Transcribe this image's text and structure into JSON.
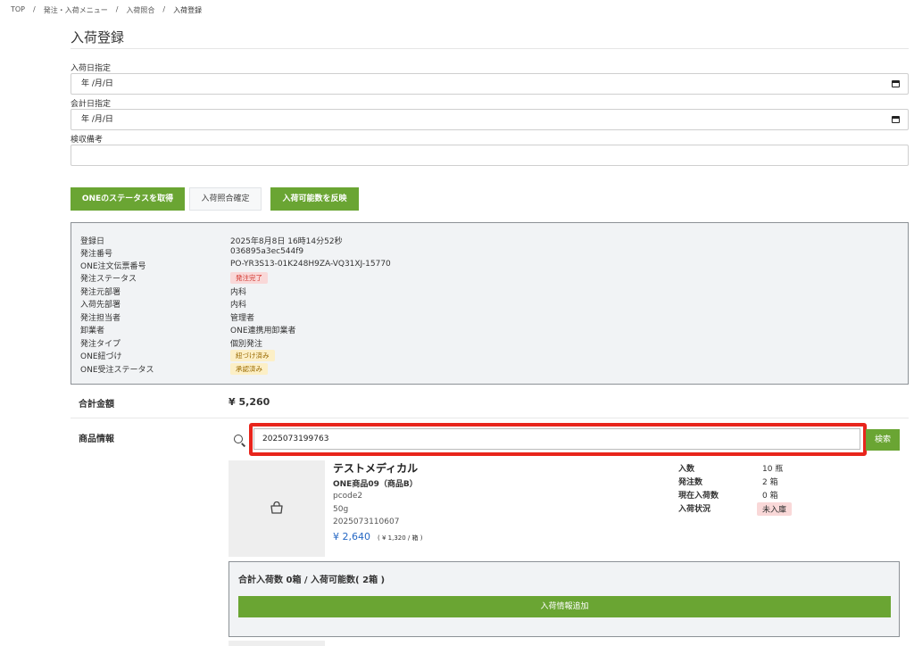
{
  "breadcrumb": [
    "TOP",
    "発注・入荷メニュー",
    "入荷照合",
    "入荷登録"
  ],
  "breadcrumb_sep": "/",
  "page_title": "入荷登録",
  "form": {
    "arrival_date_label": "入荷日指定",
    "arrival_date_value": "年 /月/日",
    "accounting_date_label": "会計日指定",
    "accounting_date_value": "年 /月/日",
    "inspection_note_label": "検収備考",
    "inspection_note_value": ""
  },
  "buttons": {
    "get_one_status": "ONEのステータスを取得",
    "confirm_matching": "入荷照合確定",
    "apply_available": "入荷可能数を反映"
  },
  "order_info": {
    "registered_label": "登録日",
    "registered_value": "2025年8月8日 16時14分52秒",
    "order_no_label": "発注番号",
    "order_no_value": "036895a3ec544f9",
    "one_slip_label": "ONE注文伝票番号",
    "one_slip_value": "PO-YR3S13-01K248H9ZA-VQ31XJ-15770",
    "order_status_label": "発注ステータス",
    "order_status_value": "発注完了",
    "from_dept_label": "発注元部署",
    "from_dept_value": "内科",
    "to_dept_label": "入荷先部署",
    "to_dept_value": "内科",
    "staff_label": "発注担当者",
    "staff_value": "管理者",
    "wholesaler_label": "卸業者",
    "wholesaler_value": "ONE連携用卸業者",
    "type_label": "発注タイプ",
    "type_value": "個別発注",
    "one_link_label": "ONE紐づけ",
    "one_link_value": "紐づけ済み",
    "one_receive_label": "ONE受注ステータス",
    "one_receive_value": "承認済み"
  },
  "total": {
    "label": "合計金額",
    "value": "¥ 5,260"
  },
  "product_section": {
    "label": "商品情報",
    "search_value": "2025073199763",
    "search_button": "検索"
  },
  "product": {
    "maker": "テストメディカル",
    "name": "ONE商品09（商品B）",
    "code": "pcode2",
    "spec": "50g",
    "jan": "2025073110607",
    "price": "¥ 2,640",
    "unit_price": "( ¥ 1,320 / 箱 )",
    "stats": {
      "qty_label": "入数",
      "qty_value": "10 瓶",
      "order_label": "発注数",
      "order_value": "2 箱",
      "current_label": "現在入荷数",
      "current_value": "0 箱",
      "state_label": "入荷状況",
      "state_value": "未入庫"
    }
  },
  "arrival": {
    "summary": "合計入荷数 0箱 / 入荷可能数( 2箱 )",
    "add_button": "入荷情報追加"
  },
  "colors": {
    "accent_green": "#6aa533",
    "highlight_red": "#e8251c",
    "price_blue": "#2668c4"
  },
  "icons": [
    "calendar-icon",
    "search-icon",
    "bag-icon"
  ]
}
